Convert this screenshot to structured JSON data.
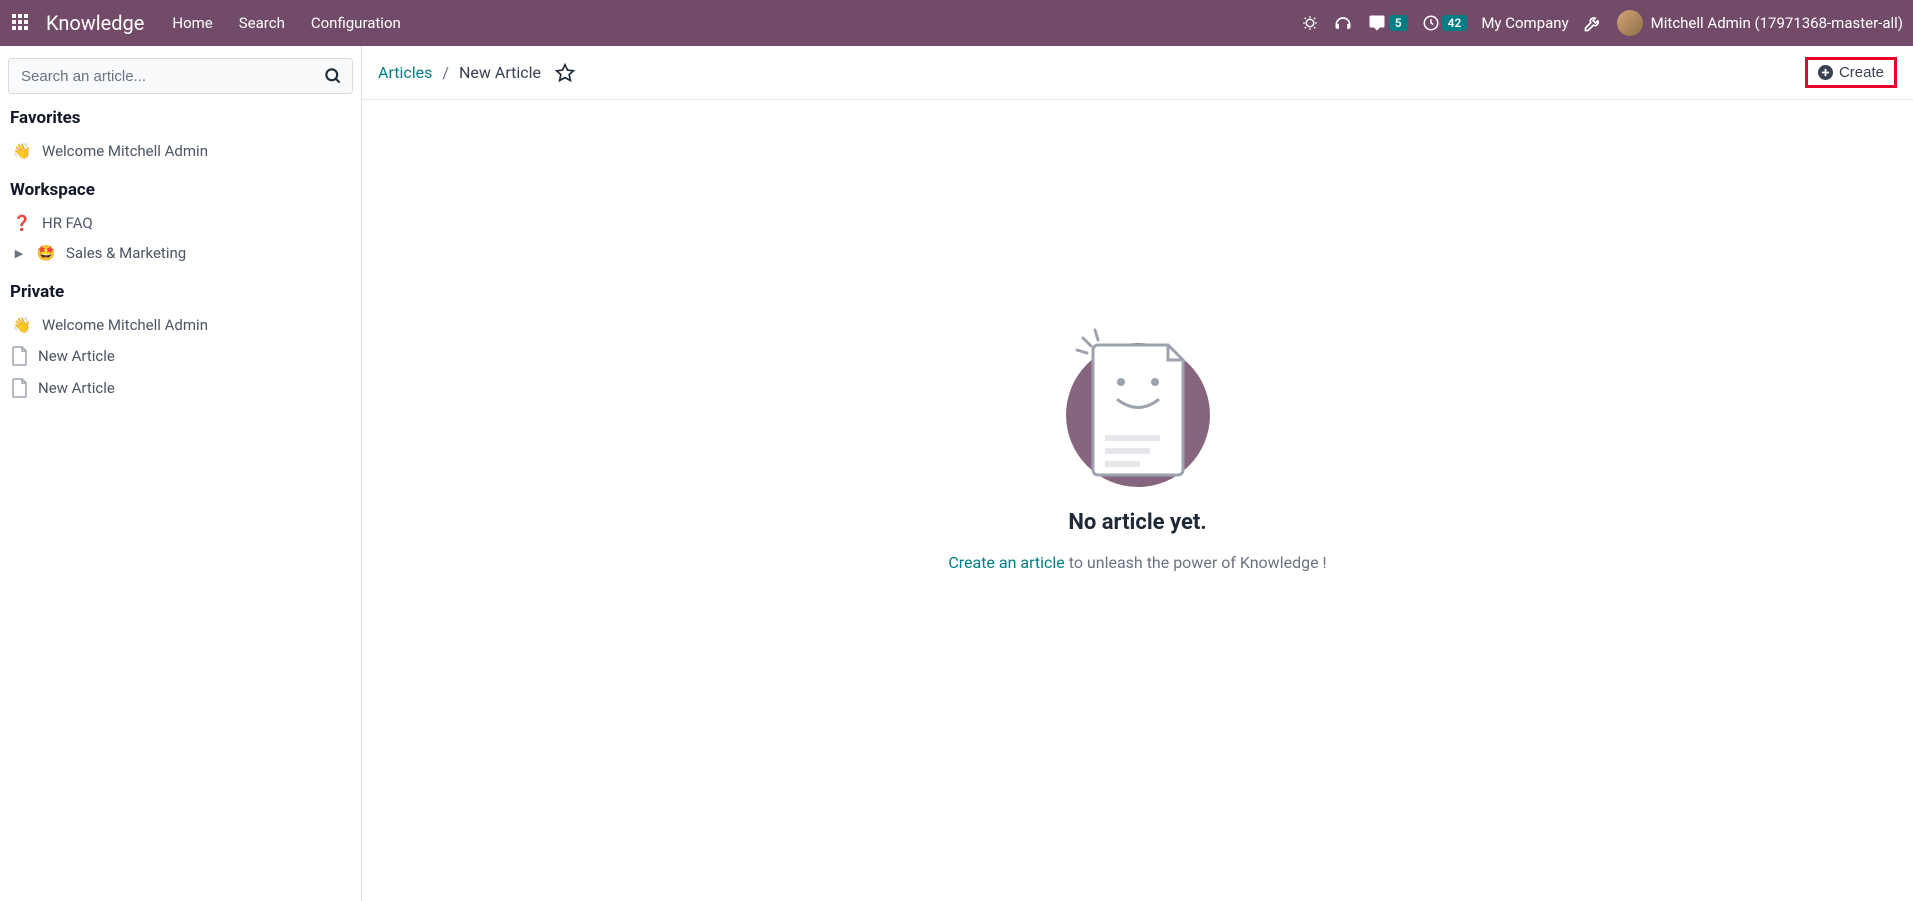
{
  "navbar": {
    "brand": "Knowledge",
    "links": [
      "Home",
      "Search",
      "Configuration"
    ],
    "messages_badge": "5",
    "activities_badge": "42",
    "company": "My Company",
    "user_name": "Mitchell Admin (17971368-master-all)"
  },
  "sidebar": {
    "search_placeholder": "Search an article...",
    "sections": {
      "favorites": {
        "title": "Favorites",
        "items": [
          {
            "emoji": "👋",
            "label": "Welcome Mitchell Admin"
          }
        ]
      },
      "workspace": {
        "title": "Workspace",
        "items": [
          {
            "emoji": "❓",
            "label": "HR FAQ",
            "has_chevron": false
          },
          {
            "emoji": "🤩",
            "label": "Sales & Marketing",
            "has_chevron": true
          }
        ]
      },
      "private": {
        "title": "Private",
        "items": [
          {
            "emoji": "👋",
            "label": "Welcome Mitchell Admin",
            "doc": false
          },
          {
            "emoji": "",
            "label": "New Article",
            "doc": true
          },
          {
            "emoji": "",
            "label": "New Article",
            "doc": true
          }
        ]
      }
    }
  },
  "breadcrumb": {
    "root": "Articles",
    "current": "New Article"
  },
  "create_button": "Create",
  "empty": {
    "title": "No article yet.",
    "link": "Create an article",
    "rest": " to unleash the power of Knowledge !"
  }
}
